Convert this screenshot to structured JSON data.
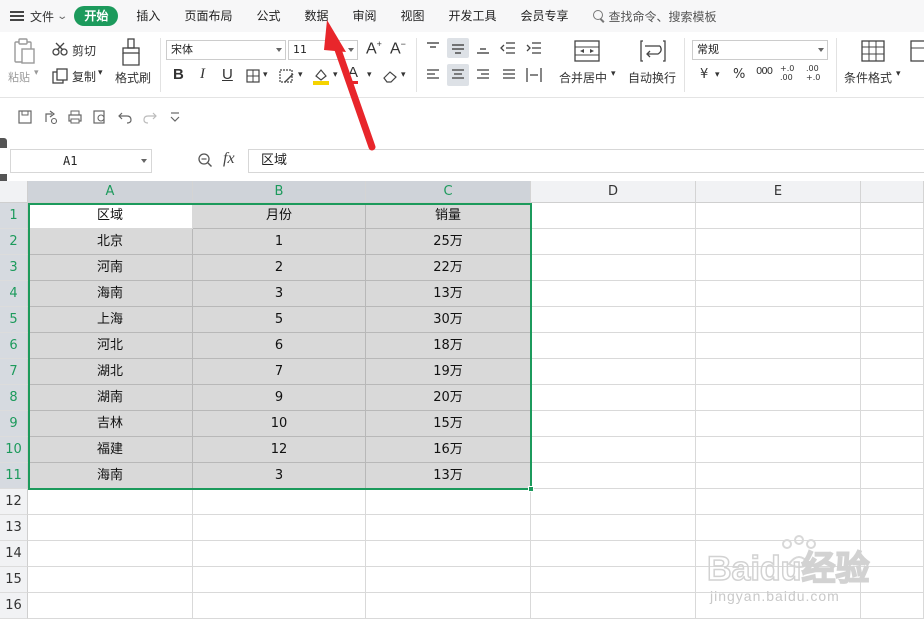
{
  "menubar": {
    "file": "文件",
    "tabs": [
      "开始",
      "插入",
      "页面布局",
      "公式",
      "数据",
      "审阅",
      "视图",
      "开发工具",
      "会员专享"
    ],
    "active_tab": "开始",
    "search_placeholder": "查找命令、搜索模板"
  },
  "ribbon": {
    "paste": "粘贴",
    "cut": "剪切",
    "copy": "复制",
    "format_painter": "格式刷",
    "font_name": "宋体",
    "font_size": "11",
    "bold": "B",
    "italic": "I",
    "underline": "U",
    "font_color_letter": "A",
    "merge_center": "合并居中",
    "wrap_text": "自动换行",
    "number_format": "常规",
    "currency": "¥",
    "percent": "%",
    "thousands": "000",
    "inc_decimal": "+.0 .00",
    "dec_decimal": ".00 +.0",
    "conditional_format": "条件格式"
  },
  "formula_bar": {
    "name_box": "A1",
    "fx": "fx",
    "content": "区域"
  },
  "sheet": {
    "columns": [
      "A",
      "B",
      "C",
      "D",
      "E"
    ],
    "row_numbers": [
      "1",
      "2",
      "3",
      "4",
      "5",
      "6",
      "7",
      "8",
      "9",
      "10",
      "11",
      "12",
      "13",
      "14",
      "15",
      "16"
    ],
    "rows": [
      [
        "区域",
        "月份",
        "销量"
      ],
      [
        "北京",
        "1",
        "25万"
      ],
      [
        "河南",
        "2",
        "22万"
      ],
      [
        "海南",
        "3",
        "13万"
      ],
      [
        "上海",
        "5",
        "30万"
      ],
      [
        "河北",
        "6",
        "18万"
      ],
      [
        "湖北",
        "7",
        "19万"
      ],
      [
        "湖南",
        "9",
        "20万"
      ],
      [
        "吉林",
        "10",
        "15万"
      ],
      [
        "福建",
        "12",
        "16万"
      ],
      [
        "海南",
        "3",
        "13万"
      ]
    ]
  },
  "watermark": {
    "brand": "Baidu经验",
    "url": "jingyan.baidu.com"
  },
  "colors": {
    "accent": "#1c9a5c",
    "arrow": "#e8262b",
    "selection_fill": "#d9d9d9"
  }
}
